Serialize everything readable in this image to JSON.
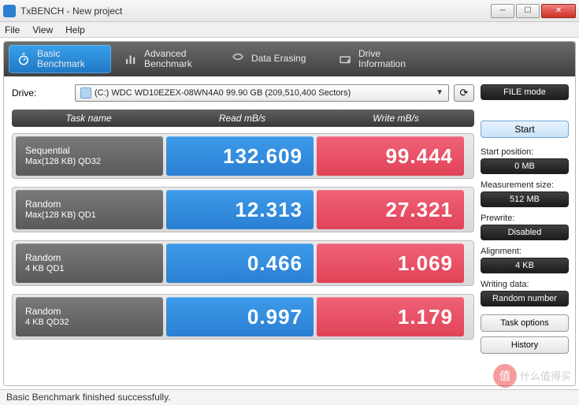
{
  "window": {
    "title": "TxBENCH - New project"
  },
  "menu": {
    "file": "File",
    "view": "View",
    "help": "Help"
  },
  "tabs": [
    {
      "line1": "Basic",
      "line2": "Benchmark"
    },
    {
      "line1": "Advanced",
      "line2": "Benchmark"
    },
    {
      "line1": "Data Erasing",
      "line2": ""
    },
    {
      "line1": "Drive",
      "line2": "Information"
    }
  ],
  "drive": {
    "label": "Drive:",
    "value": "(C:) WDC WD10EZEX-08WN4A0  99.90 GB (209,510,400 Sectors)"
  },
  "fileMode": "FILE mode",
  "headers": {
    "task": "Task name",
    "read": "Read mB/s",
    "write": "Write mB/s"
  },
  "rows": [
    {
      "name1": "Sequential",
      "name2": "Max(128 KB) QD32",
      "read": "132.609",
      "write": "99.444"
    },
    {
      "name1": "Random",
      "name2": "Max(128 KB) QD1",
      "read": "12.313",
      "write": "27.321"
    },
    {
      "name1": "Random",
      "name2": "4 KB QD1",
      "read": "0.466",
      "write": "1.069"
    },
    {
      "name1": "Random",
      "name2": "4 KB QD32",
      "read": "0.997",
      "write": "1.179"
    }
  ],
  "side": {
    "start": "Start",
    "startPosLabel": "Start position:",
    "startPosValue": "0 MB",
    "measLabel": "Measurement size:",
    "measValue": "512 MB",
    "prewriteLabel": "Prewrite:",
    "prewriteValue": "Disabled",
    "alignLabel": "Alignment:",
    "alignValue": "4 KB",
    "writeDataLabel": "Writing data:",
    "writeDataValue": "Random number",
    "taskOptions": "Task options",
    "history": "History"
  },
  "status": "Basic Benchmark finished successfully.",
  "watermark": "什么值得买"
}
